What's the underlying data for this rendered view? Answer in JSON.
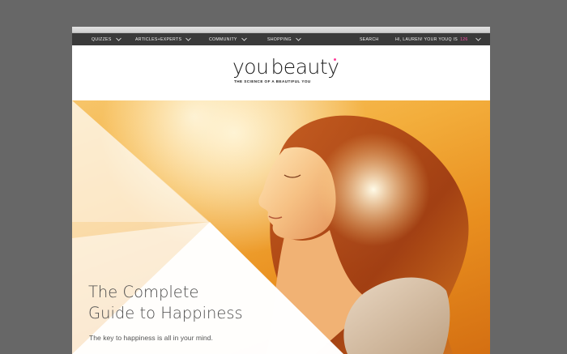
{
  "nav": {
    "items": [
      {
        "label": "QUIZZES"
      },
      {
        "label": "ARTICLES+EXPERTS"
      },
      {
        "label": "COMMUNITY"
      },
      {
        "label": "SHOPPING"
      }
    ],
    "search_label": "SEARCH",
    "user": {
      "greeting": "HI, LAUREN! YOUR YOUQ IS",
      "youq_value": "126"
    }
  },
  "brand": {
    "logo_part1": "you",
    "logo_part2": "beauty",
    "tagline": "THE SCIENCE OF A BEAUTIFUL YOU"
  },
  "hero": {
    "title_line1": "The Complete",
    "title_line2": "Guide to Happiness",
    "subtitle": "The key to happiness is all in your mind."
  },
  "colors": {
    "page_background": "#676767",
    "nav_background": "#3a3a3a",
    "accent_pink": "#ff4fa8",
    "hero_warm": "#f3ae3c"
  },
  "icons": {
    "dropdown": "chevron-down-icon"
  }
}
